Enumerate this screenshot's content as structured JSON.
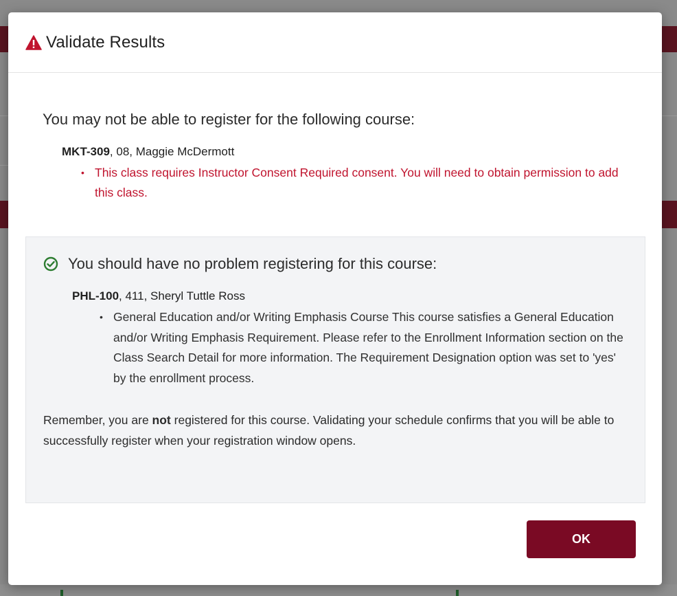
{
  "dialog": {
    "title": "Validate Results",
    "warning_icon": "warning-triangle-icon",
    "ok_label": "OK"
  },
  "error_section": {
    "lead": "You may not be able to register for the following course:",
    "course": {
      "code": "MKT-309",
      "details": ", 08, Maggie McDermott"
    },
    "messages": [
      "This class requires Instructor Consent Required consent. You will need to obtain permission to add this class."
    ]
  },
  "ok_section": {
    "icon": "check-circle-icon",
    "lead": "You should have no problem registering for this course:",
    "course": {
      "code": "PHL-100",
      "details": ", 411, Sheryl Tuttle Ross"
    },
    "messages": [
      "General Education and/or Writing Emphasis Course This course satisfies a General Education and/or Writing Emphasis Requirement. Please refer to the Enrollment Information section on the Class Search Detail for more information. The Requirement Designation option was set to 'yes' by the enrollment process."
    ],
    "remember": {
      "prefix": "Remember, you are ",
      "emphasis": "not",
      "suffix": " registered for this course. Validating your schedule confirms that you will be able to successfully register when your registration window opens."
    }
  },
  "colors": {
    "brand": "#7a0a24",
    "error": "#c0142e",
    "success": "#2e7d32",
    "panel_bg": "#f3f4f6"
  }
}
